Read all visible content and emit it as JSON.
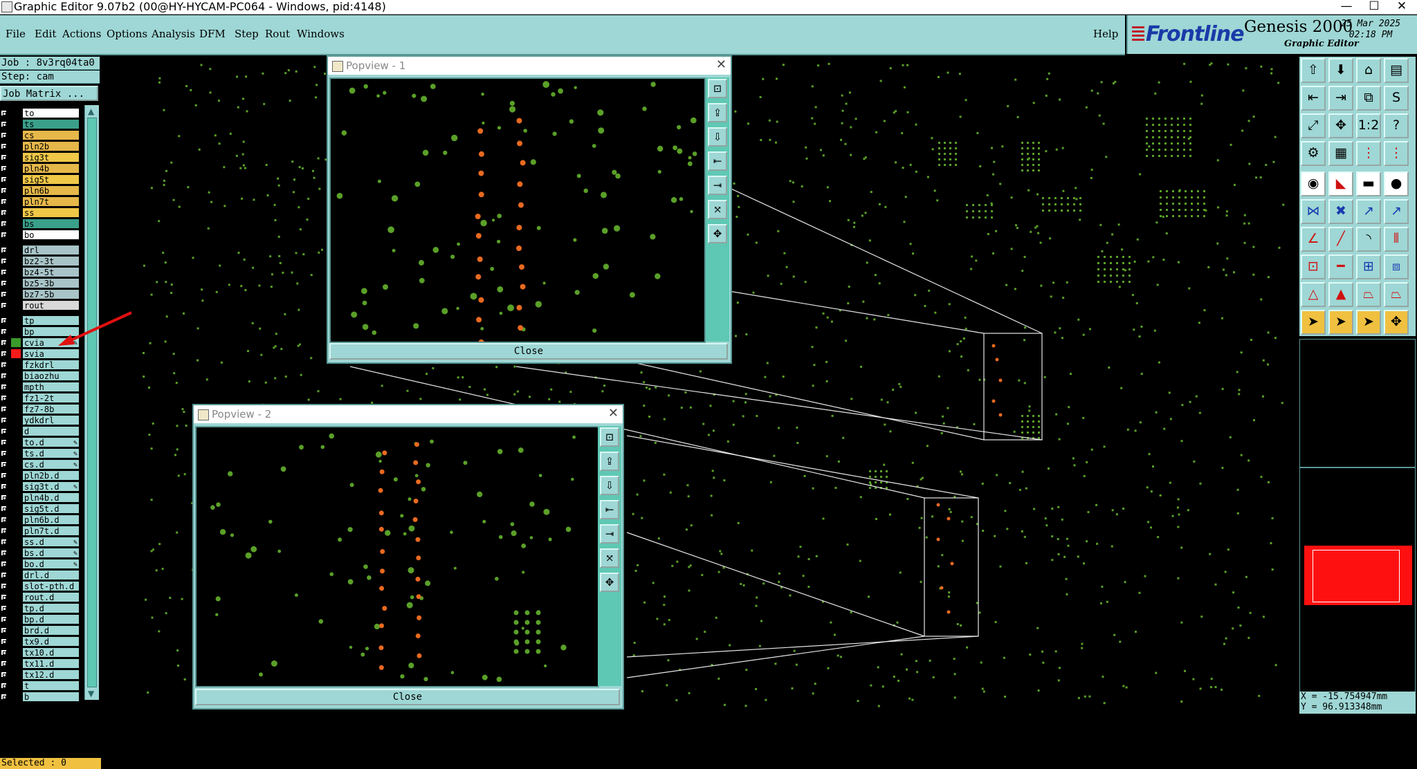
{
  "window": {
    "title": "Graphic Editor 9.07b2 (00@HY-HYCAM-PC064 - Windows, pid:4148)",
    "minimize": "—",
    "maximize": "☐",
    "close": "✕"
  },
  "menu": {
    "items": [
      "File",
      "Edit",
      "Actions",
      "Options",
      "Analysis",
      "DFM",
      "Step",
      "Rout",
      "Windows"
    ],
    "help": "Help"
  },
  "brand": {
    "logo": "Frontline",
    "product": "Genesis 2000",
    "subtitle": "Graphic Editor",
    "date": "25 Mar 2025",
    "time": "02:18 PM"
  },
  "left_panel": {
    "job": "Job : 8v3rq04ta0",
    "step": "Step: cam",
    "job_matrix": "Job Matrix ...",
    "selected": "Selected : 0"
  },
  "layers": [
    {
      "name": "to",
      "color": "#ffffff",
      "sw": ""
    },
    {
      "name": "ts",
      "color": "#3aa08a",
      "sw": ""
    },
    {
      "name": "cs",
      "color": "#e6b84a",
      "sw": ""
    },
    {
      "name": "pln2b",
      "color": "#e6b84a",
      "sw": ""
    },
    {
      "name": "sig3t",
      "color": "#f0c848",
      "sw": ""
    },
    {
      "name": "pln4b",
      "color": "#e6b84a",
      "sw": ""
    },
    {
      "name": "sig5t",
      "color": "#f0c848",
      "sw": ""
    },
    {
      "name": "pln6b",
      "color": "#e6b84a",
      "sw": ""
    },
    {
      "name": "pln7t",
      "color": "#e6b84a",
      "sw": ""
    },
    {
      "name": "ss",
      "color": "#f0c848",
      "sw": ""
    },
    {
      "name": "bs",
      "color": "#3aa08a",
      "sw": ""
    },
    {
      "name": "bo",
      "color": "#ffffff",
      "sw": ""
    },
    {
      "name": "drl",
      "color": "#a8c4c8",
      "sw": ""
    },
    {
      "name": "bz2-3t",
      "color": "#a8c4c8",
      "sw": ""
    },
    {
      "name": "bz4-5t",
      "color": "#a8c4c8",
      "sw": ""
    },
    {
      "name": "bz5-3b",
      "color": "#a8c4c8",
      "sw": ""
    },
    {
      "name": "bz7-5b",
      "color": "#a8c4c8",
      "sw": ""
    },
    {
      "name": "rout",
      "color": "#d8d8d8",
      "sw": ""
    },
    {
      "name": "tp",
      "color": "#9ed7d5",
      "sw": ""
    },
    {
      "name": "bp",
      "color": "#9ed7d5",
      "sw": ""
    },
    {
      "name": "cvia",
      "color": "#9ed7d5",
      "sw": "#3a9a2a",
      "mark": "✎"
    },
    {
      "name": "svia",
      "color": "#9ed7d5",
      "sw": "#ff1a1a"
    },
    {
      "name": "fzkdrl",
      "color": "#9ed7d5",
      "sw": ""
    },
    {
      "name": "biaozhu",
      "color": "#9ed7d5",
      "sw": ""
    },
    {
      "name": "mpth",
      "color": "#9ed7d5",
      "sw": ""
    },
    {
      "name": "fz1-2t",
      "color": "#9ed7d5",
      "sw": ""
    },
    {
      "name": "fz7-8b",
      "color": "#9ed7d5",
      "sw": ""
    },
    {
      "name": "ydkdrl",
      "color": "#9ed7d5",
      "sw": ""
    },
    {
      "name": "d",
      "color": "#9ed7d5",
      "sw": ""
    },
    {
      "name": "to.d",
      "color": "#9ed7d5",
      "sw": "",
      "mark": "✎"
    },
    {
      "name": "ts.d",
      "color": "#9ed7d5",
      "sw": "",
      "mark": "✎"
    },
    {
      "name": "cs.d",
      "color": "#9ed7d5",
      "sw": "",
      "mark": "✎"
    },
    {
      "name": "pln2b.d",
      "color": "#9ed7d5",
      "sw": ""
    },
    {
      "name": "sig3t.d",
      "color": "#9ed7d5",
      "sw": "",
      "mark": "✎"
    },
    {
      "name": "pln4b.d",
      "color": "#9ed7d5",
      "sw": ""
    },
    {
      "name": "sig5t.d",
      "color": "#9ed7d5",
      "sw": ""
    },
    {
      "name": "pln6b.d",
      "color": "#9ed7d5",
      "sw": ""
    },
    {
      "name": "pln7t.d",
      "color": "#9ed7d5",
      "sw": ""
    },
    {
      "name": "ss.d",
      "color": "#9ed7d5",
      "sw": "",
      "mark": "✎"
    },
    {
      "name": "bs.d",
      "color": "#9ed7d5",
      "sw": "",
      "mark": "✎"
    },
    {
      "name": "bo.d",
      "color": "#9ed7d5",
      "sw": "",
      "mark": "✎"
    },
    {
      "name": "drl.d",
      "color": "#9ed7d5",
      "sw": ""
    },
    {
      "name": "slot-pth.d",
      "color": "#9ed7d5",
      "sw": ""
    },
    {
      "name": "rout.d",
      "color": "#9ed7d5",
      "sw": ""
    },
    {
      "name": "tp.d",
      "color": "#9ed7d5",
      "sw": ""
    },
    {
      "name": "bp.d",
      "color": "#9ed7d5",
      "sw": ""
    },
    {
      "name": "brd.d",
      "color": "#9ed7d5",
      "sw": ""
    },
    {
      "name": "tx9.d",
      "color": "#9ed7d5",
      "sw": ""
    },
    {
      "name": "tx10.d",
      "color": "#9ed7d5",
      "sw": ""
    },
    {
      "name": "tx11.d",
      "color": "#9ed7d5",
      "sw": ""
    },
    {
      "name": "tx12.d",
      "color": "#9ed7d5",
      "sw": ""
    },
    {
      "name": "t",
      "color": "#9ed7d5",
      "sw": ""
    },
    {
      "name": "b",
      "color": "#9ed7d5",
      "sw": ""
    }
  ],
  "popview1": {
    "title": "Popview - 1",
    "close": "Close"
  },
  "popview2": {
    "title": "Popview - 2",
    "close": "Close"
  },
  "coords": {
    "x": "X = -15.754947mm",
    "y": "Y = 96.913348mm"
  },
  "colors": {
    "panel": "#9ed7d5",
    "pad_green": "#5aa028",
    "pad_orange": "#e86a20",
    "selection": "#ff1010"
  }
}
